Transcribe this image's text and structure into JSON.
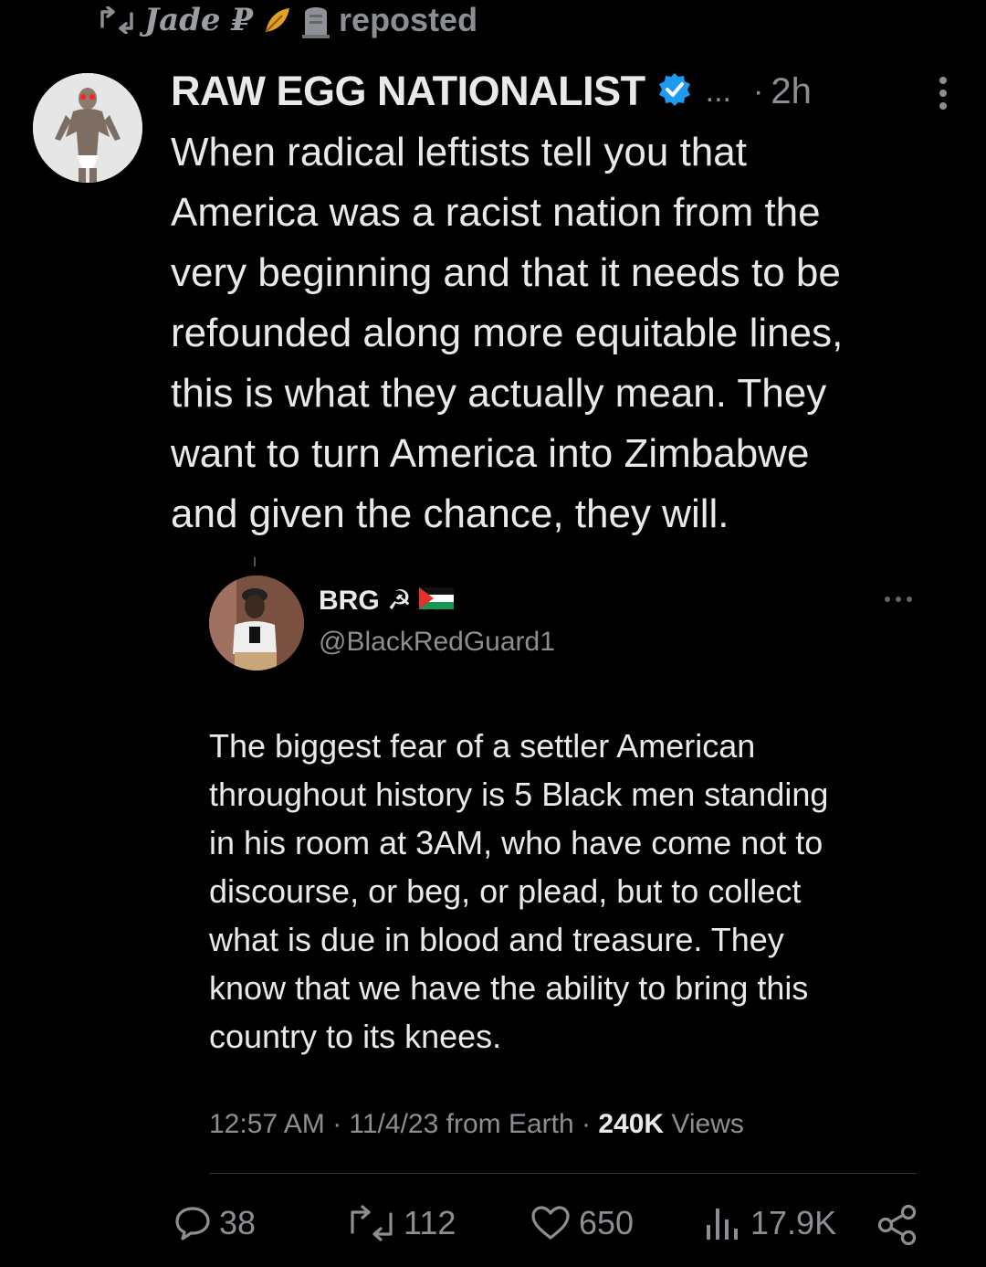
{
  "repost": {
    "reposter_name": "Jade ₽",
    "label": "reposted"
  },
  "post": {
    "display_name": "RAW EGG NATIONALIST",
    "truncation": "...",
    "separator": "·",
    "time": "2h",
    "text": "When radical leftists tell you that\nAmerica was a racist nation from the\nvery beginning and that it needs to be\nrefounded along more equitable lines,\nthis is what they actually mean. They\nwant to turn America into Zimbabwe\nand given the chance, they will."
  },
  "quoted": {
    "display_name": "BRG ☭",
    "handle": "@BlackRedGuard1",
    "text": "The biggest fear of a settler American\nthroughout history is 5 Black men standing\nin his room at 3AM, who have come not to\ndiscourse, or beg, or plead, but to collect\nwhat is due in blood and treasure. They\nknow that we have the ability to bring this\ncountry to its knees.",
    "meta_time": "12:57 AM · 11/4/23 from Earth · ",
    "views_count": "240K",
    "views_label": " Views"
  },
  "actions": {
    "replies": "38",
    "reposts": "112",
    "likes": "650",
    "views": "17.9K"
  },
  "colors": {
    "background": "#000000",
    "text": "#e7e9ea",
    "muted": "#8b8f94",
    "verified": "#1d9bf0"
  },
  "icons": [
    "repost-icon",
    "leaf-icon",
    "tombstone-icon",
    "verified-badge-icon",
    "more-vertical-icon",
    "hammer-sickle-icon",
    "palestine-flag-icon",
    "more-horizontal-icon",
    "reply-icon",
    "like-icon",
    "views-icon",
    "share-icon"
  ]
}
